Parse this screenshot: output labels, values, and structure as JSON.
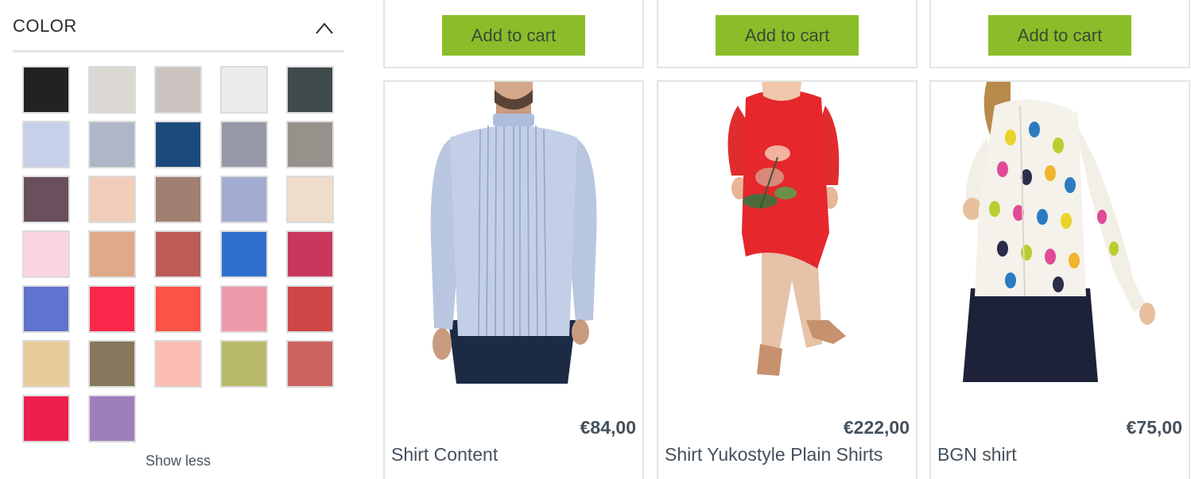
{
  "filter": {
    "title": "COLOR",
    "collapse_icon": "chevron-up-icon",
    "show_less_label": "Show less",
    "swatches": [
      "#222222",
      "#dbd8d3",
      "#cbc3bf",
      "#ebebeb",
      "#3f4a4c",
      "#c6d0e8",
      "#aeb6c7",
      "#1d4a7d",
      "#9698a8",
      "#96918a",
      "#6a4f5c",
      "#efcdb9",
      "#a07f70",
      "#a1acd0",
      "#efdccb",
      "#fad4e3",
      "#deaa89",
      "#bd5b57",
      "#2f6fcb",
      "#c9385c",
      "#5f73cf",
      "#f9284a",
      "#fd5247",
      "#ed99a9",
      "#ce4746",
      "#e8cc9a",
      "#87775d",
      "#fbbcb4",
      "#b9b96a",
      "#cd6360",
      "#ee1e4d",
      "#9c7fbc"
    ]
  },
  "top_row": {
    "add_to_cart_label": "Add to cart",
    "accent": "#8bbd2a"
  },
  "products": [
    {
      "name": "Shirt Content",
      "price": "€84,00"
    },
    {
      "name": "Shirt Yukostyle Plain Shirts",
      "price": "€222,00"
    },
    {
      "name": "BGN shirt",
      "price": "€75,00"
    }
  ]
}
